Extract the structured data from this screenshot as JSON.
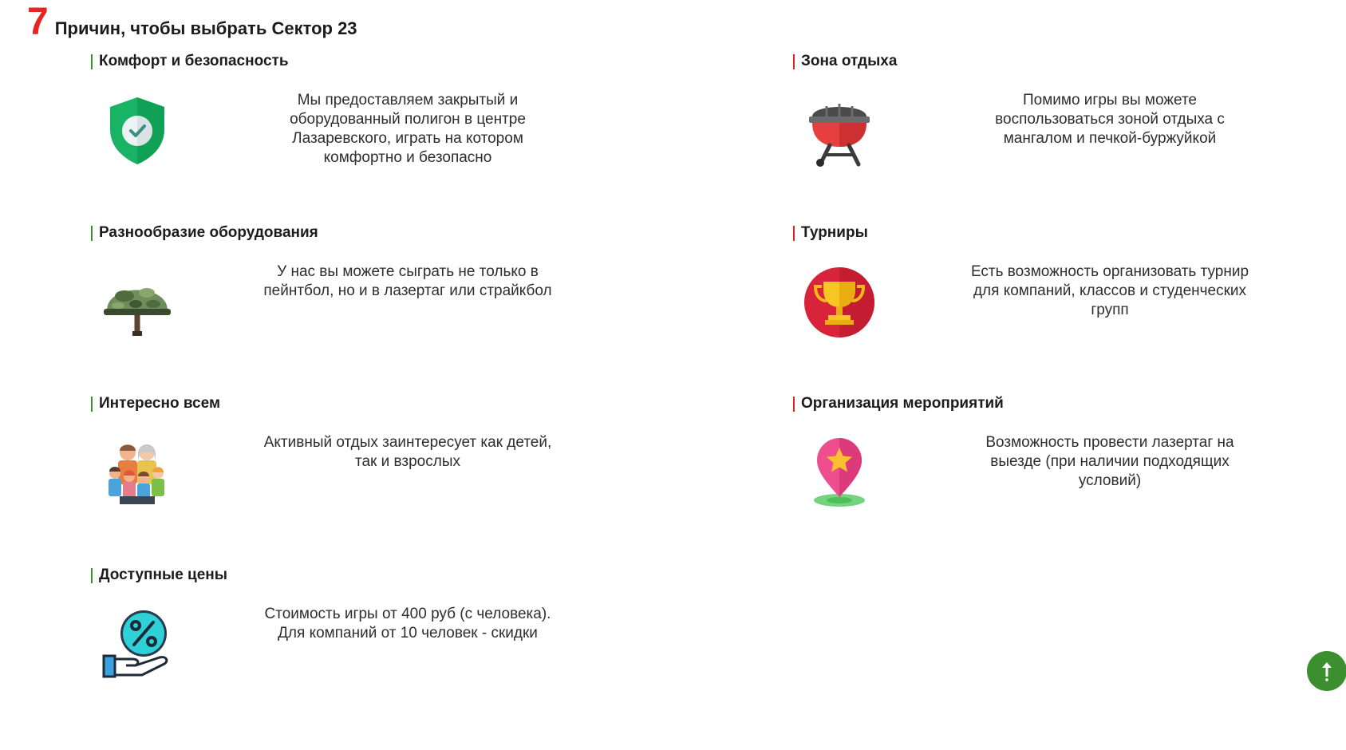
{
  "heading": {
    "number": "7",
    "text": "Причин, чтобы выбрать Сектор 23"
  },
  "colors": {
    "accent_red": "#e52523",
    "accent_green": "#3b8f2e"
  },
  "features": [
    {
      "title": "Комфорт и безопасность",
      "icon": "shield-check-icon",
      "text": "Мы предоставляем закрытый и оборудованный полигон в центре Лазаревского, играть на котором комфортно и безопасно"
    },
    {
      "title": "Зона отдыха",
      "icon": "grill-icon",
      "text": "Помимо игры вы можете воспользоваться зоной отдыха с мангалом и печкой-буржуйкой"
    },
    {
      "title": "Разнообразие оборудования",
      "icon": "army-helmet-icon",
      "text": "У нас вы можете сыграть не только в пейнтбол, но и в лазертаг или страйкбол"
    },
    {
      "title": "Турниры",
      "icon": "trophy-icon",
      "text": "Есть возможность организовать турнир для компаний, классов и студенческих групп"
    },
    {
      "title": "Интересно всем",
      "icon": "family-icon",
      "text": "Активный отдых заинтересует как детей, так и взрослых"
    },
    {
      "title": "Организация мероприятий",
      "icon": "location-star-icon",
      "text": "Возможность провести лазертаг на выезде (при наличии подходящих условий)"
    },
    {
      "title": "Доступные цены",
      "icon": "discount-hand-icon",
      "text": "Стоимость игры от 400 руб (с человека). Для компаний от 10 человек - скидки"
    }
  ],
  "scroll_top": {
    "icon": "arrow-up-icon"
  }
}
